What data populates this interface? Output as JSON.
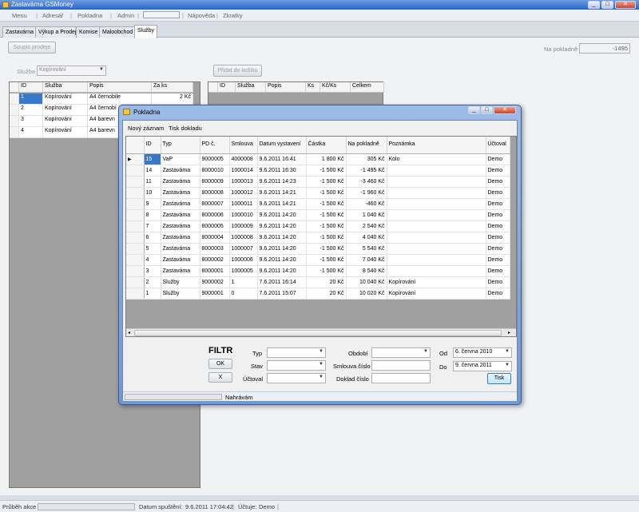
{
  "window": {
    "title": "Zastavárna GSMoney"
  },
  "menu": [
    "Menu",
    "Adresář",
    "Pokladna",
    "Admin",
    "Nápověda",
    "Zkratky"
  ],
  "tabs": [
    "Zastavárna",
    "Výkup a Prodej",
    "Komise",
    "Maloobchod",
    "Služby"
  ],
  "services": {
    "soupis_button": "Soupis prodeje",
    "na_pokladne_label": "Na pokladně",
    "na_pokladne_value": "-1495",
    "sluzba_label": "Služba",
    "sluzba_value": "Kopírování",
    "pridat_button": "Přidat do košíku",
    "left_grid": {
      "headers": [
        "ID",
        "Služba",
        "Popis",
        "Za ks"
      ],
      "rows": [
        [
          "1",
          "Kopírování",
          "A4 černobile",
          "2 Kč"
        ],
        [
          "2",
          "Kopírování",
          "A4 černobí",
          ""
        ],
        [
          "3",
          "Kopírování",
          "A4 barevn",
          ""
        ],
        [
          "4",
          "Kopírování",
          "A4 barevn",
          ""
        ]
      ]
    },
    "right_grid": {
      "headers": [
        "ID",
        "Služba",
        "Popis",
        "Ks",
        "Kč/Ks",
        "Celkem"
      ]
    }
  },
  "dialog": {
    "title": "Pokladna",
    "menu": [
      "Nový záznam",
      "Tisk dokladu"
    ],
    "headers": [
      "ID",
      "Typ",
      "PD č.",
      "Smlouva",
      "Datum vystavení",
      "Částka",
      "Na pokladně",
      "Poznámka",
      "Účtoval"
    ],
    "rows": [
      [
        "15",
        "VaP",
        "9000005",
        "4000008",
        "9.6.2011 16:41",
        "1 800 Kč",
        "305 Kč",
        "Kolo",
        "Demo"
      ],
      [
        "14",
        "Zastaváma",
        "8000010",
        "1000014",
        "9.6.2011 16:30",
        "-1 500 Kč",
        "-1 495 Kč",
        "",
        "Demo"
      ],
      [
        "11",
        "Zastaváma",
        "8000009",
        "1000013",
        "9.6.2011 14:23",
        "-1 500 Kč",
        "-3 460 Kč",
        "",
        "Demo"
      ],
      [
        "10",
        "Zastaváma",
        "8000008",
        "1000012",
        "9.6.2011 14:21",
        "-1 500 Kč",
        "-1 960 Kč",
        "",
        "Demo"
      ],
      [
        "9",
        "Zastaváma",
        "8000007",
        "1000011",
        "9.6.2011 14:21",
        "-1 500 Kč",
        "-460 Kč",
        "",
        "Demo"
      ],
      [
        "8",
        "Zastaváma",
        "8000006",
        "1000010",
        "9.6.2011 14:20",
        "-1 500 Kč",
        "1 040 Kč",
        "",
        "Demo"
      ],
      [
        "7",
        "Zastaváma",
        "8000005",
        "1000009",
        "9.6.2011 14:20",
        "-1 500 Kč",
        "2 540 Kč",
        "",
        "Demo"
      ],
      [
        "6",
        "Zastaváma",
        "8000004",
        "1000008",
        "9.6.2011 14:20",
        "-1 500 Kč",
        "4 040 Kč",
        "",
        "Demo"
      ],
      [
        "5",
        "Zastaváma",
        "8000003",
        "1000007",
        "9.6.2011 14:20",
        "-1 500 Kč",
        "5 540 Kč",
        "",
        "Demo"
      ],
      [
        "4",
        "Zastaváma",
        "8000002",
        "1000006",
        "9.6.2011 14:20",
        "-1 500 Kč",
        "7 040 Kč",
        "",
        "Demo"
      ],
      [
        "3",
        "Zastaváma",
        "8000001",
        "1000005",
        "9.6.2011 14:20",
        "-1 500 Kč",
        "8 540 Kč",
        "",
        "Demo"
      ],
      [
        "2",
        "Služby",
        "9000002",
        "1",
        "7.6.2011 16:14",
        "20 Kč",
        "10 040 Kč",
        "Kopírování",
        "Demo"
      ],
      [
        "1",
        "Služby",
        "9000001",
        "0",
        "7.6.2011 15:07",
        "20 Kč",
        "10 020 Kč",
        "Kopírování",
        "Demo"
      ]
    ],
    "filter": {
      "title": "FILTR",
      "ok": "OK",
      "x": "X",
      "typ_label": "Typ",
      "stav_label": "Stav",
      "uctoval_label": "Účtoval",
      "obdobi_label": "Období",
      "smlouva_label": "Smlouva číslo",
      "doklad_label": "Doklad číslo",
      "od_label": "Od",
      "do_label": "Do",
      "od_day": "6.",
      "od_month": "června",
      "od_year": "2010",
      "do_day": "9.",
      "do_month": "června",
      "do_year": "2011",
      "tisk": "Tisk"
    },
    "status": "Nahrávám"
  },
  "statusbar": {
    "progress_label": "Průběh akce",
    "datum_label": "Datum spuštění:",
    "datum_value": "9.6.2011 17:04:42",
    "uctuje_label": "Účtuje:",
    "uctuje_value": "Demo"
  }
}
